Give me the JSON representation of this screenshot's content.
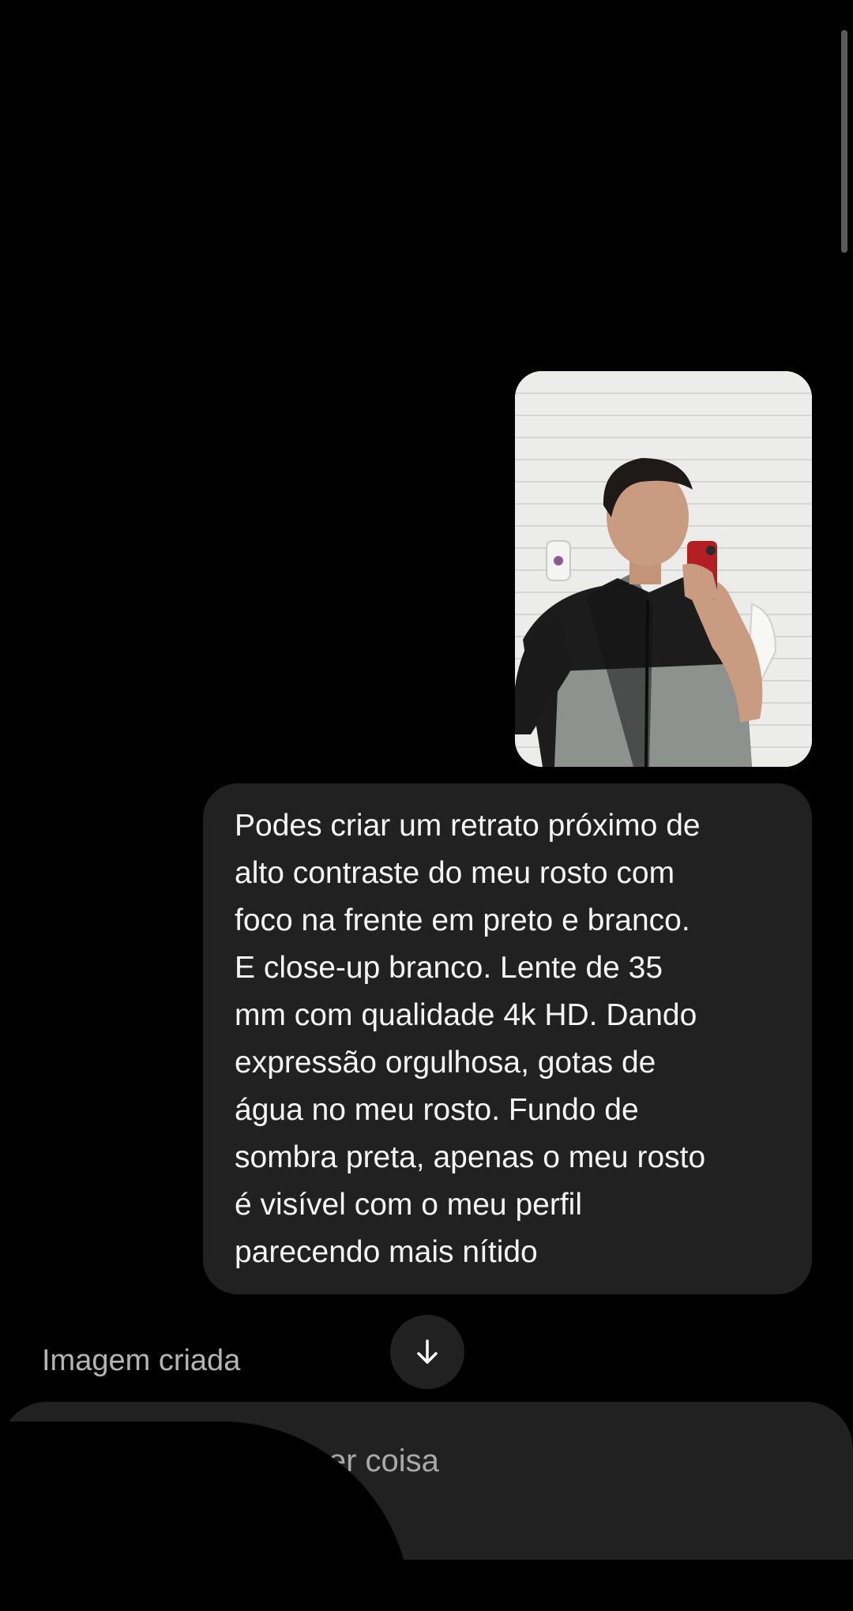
{
  "chat": {
    "user_message": {
      "lines": [
        "Podes criar um retrato próximo de",
        "alto contraste do meu rosto com",
        "foco na frente em preto e branco.",
        "E close-up branco. Lente de 35",
        "mm com qualidade 4k HD. Dando",
        "expressão orgulhosa, gotas de",
        "água no meu rosto. Fundo de",
        "sombra preta, apenas o meu rosto",
        "é visível com o meu perfil",
        "parecendo mais nítido"
      ]
    },
    "status_label": "Imagem criada"
  },
  "composer": {
    "placeholder_fragment": "ualquer coisa"
  },
  "icons": {
    "scroll_down": "arrow-down-icon"
  },
  "colors": {
    "background": "#000000",
    "bubble": "#212121",
    "text": "#f5f5f5",
    "muted_text": "#b4b4b4"
  }
}
